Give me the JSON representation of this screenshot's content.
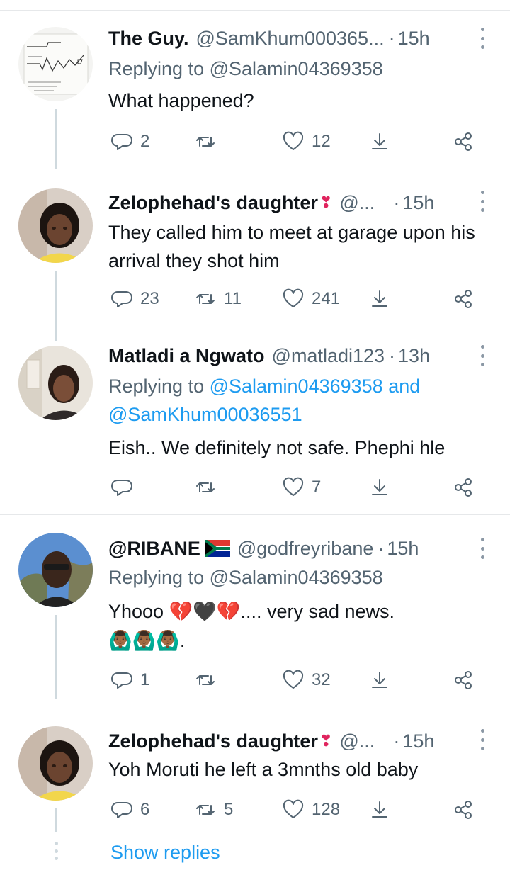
{
  "tweets": [
    {
      "name": "The Guy.",
      "name_emoji": "",
      "handle": "@SamKhum000365...",
      "sep": "·",
      "time": "15h",
      "replying_prefix": "Replying to ",
      "replying_to": "@Salamin04369358",
      "replying_and": "",
      "replying_to_2": "",
      "text": "What happened?",
      "replies": "2",
      "retweets": "",
      "likes": "12"
    },
    {
      "name": "Zelophehad's daughter",
      "name_emoji": "❣",
      "handle": "@...",
      "sep": "·",
      "time": "15h",
      "text": "They called him to meet at garage upon his arrival they shot him",
      "replies": "23",
      "retweets": "11",
      "likes": "241"
    },
    {
      "name": "Matladi a Ngwato",
      "handle": "@matladi123",
      "sep": "·",
      "time": "13h",
      "replying_prefix": "Replying to ",
      "replying_to": "@Salamin04369358",
      "replying_and": " and",
      "replying_to_2": "@SamKhum00036551",
      "text": "Eish.. We definitely not safe. Phephi hle",
      "replies": "",
      "retweets": "",
      "likes": "7"
    },
    {
      "name": "@RIBANE",
      "handle": "@godfreyribane",
      "sep": "·",
      "time": "15h",
      "replying_prefix": "Replying to ",
      "replying_to": "@Salamin04369358",
      "text_prefix": "Yhooo ",
      "text_emojis": "💔🖤💔",
      "text_suffix": ".... very sad news.",
      "text_line2_emojis": "🙆🏾‍♂️🙆🏾‍♂️🙆🏾‍♂️",
      "text_line2_suffix": ".",
      "replies": "1",
      "retweets": "",
      "likes": "32"
    },
    {
      "name": "Zelophehad's daughter",
      "name_emoji": "❣",
      "handle": "@...",
      "sep": "·",
      "time": "15h",
      "text": "Yoh Moruti he left a 3mnths old baby",
      "replies": "6",
      "retweets": "5",
      "likes": "128"
    }
  ],
  "show_replies": "Show replies",
  "icons": {
    "reply": "reply-icon",
    "retweet": "retweet-icon",
    "like": "heart-icon",
    "share": "share-icon",
    "more": "more-icon"
  },
  "colors": {
    "link": "#1d9bf0",
    "secondary": "#536471",
    "primary": "#0f1419"
  }
}
